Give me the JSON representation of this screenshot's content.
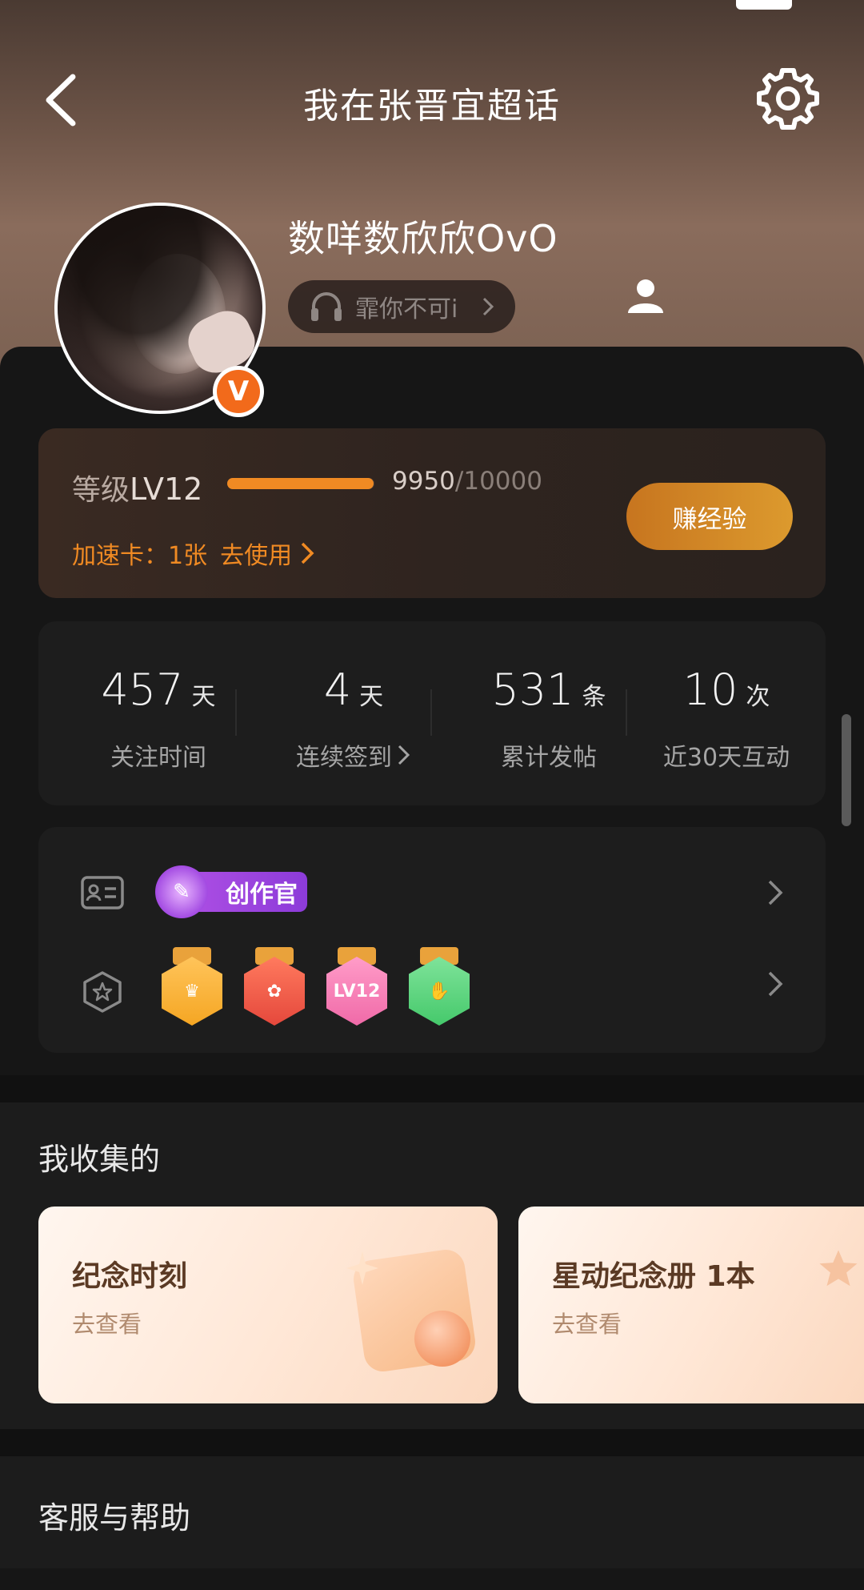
{
  "header": {
    "title": "我在张晋宜超话"
  },
  "profile": {
    "username": "数咩数欣欣OvO",
    "verified_badge": "V",
    "music_label": "霏你不可i"
  },
  "level": {
    "prefix": "等级",
    "level": "LV12",
    "current": "9950",
    "max": "/10000",
    "progress_fraction": 0.995,
    "boost_text": "加速卡：1张",
    "boost_action": "去使用",
    "earn_button": "赚经验"
  },
  "stats": [
    {
      "value": "457",
      "unit": "天",
      "label": "关注时间",
      "has_arrow": false
    },
    {
      "value": "4",
      "unit": "天",
      "label": "连续签到",
      "has_arrow": true
    },
    {
      "value": "531",
      "unit": "条",
      "label": "累计发帖",
      "has_arrow": false
    },
    {
      "value": "10",
      "unit": "次",
      "label": "近30天互动",
      "has_arrow": false
    }
  ],
  "badges": {
    "creator_tag": "创作官",
    "medals": [
      {
        "name": "crown-medal-icon",
        "text": "",
        "color": "#f5a623"
      },
      {
        "name": "mascot-medal-icon",
        "text": "",
        "color": "#e5483c"
      },
      {
        "name": "lv12-medal-icon",
        "text": "LV12",
        "color": "#f06aa8"
      },
      {
        "name": "hand-medal-icon",
        "text": "",
        "color": "#45c96b"
      }
    ]
  },
  "collections": {
    "title": "我收集的",
    "cards": [
      {
        "title": "纪念时刻",
        "link": "去查看"
      },
      {
        "title": "星动纪念册  1本",
        "link": "去查看"
      }
    ]
  },
  "help": {
    "title": "客服与帮助"
  },
  "colors": {
    "accent": "#f08a23",
    "verified": "#f26a1b",
    "creator": "#a34be2",
    "sheet_bg": "#161616"
  }
}
